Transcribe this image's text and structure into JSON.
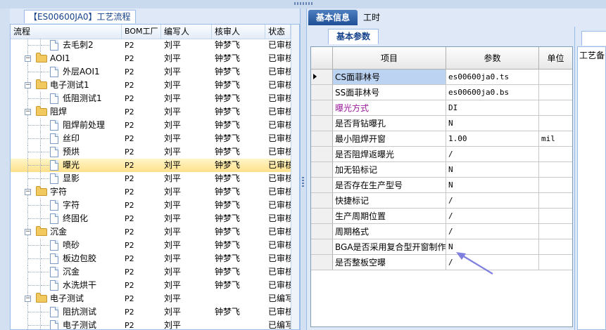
{
  "left_panel": {
    "tab_title": "【ES00600JA0】工艺流程",
    "columns": [
      "流程",
      "BOM工厂",
      "编写人",
      "核审人",
      "状态"
    ],
    "rows": [
      {
        "type": "leaf",
        "level": 2,
        "name": "去毛刺2",
        "bom": "P2",
        "writer": "刘平",
        "reviewer": "钟梦飞",
        "status": "已审核"
      },
      {
        "type": "folder",
        "level": 1,
        "name": "AOI1",
        "bom": "P2",
        "writer": "刘平",
        "reviewer": "钟梦飞",
        "status": "已审核"
      },
      {
        "type": "leaf",
        "level": 2,
        "name": "外层AOI1",
        "bom": "P2",
        "writer": "刘平",
        "reviewer": "钟梦飞",
        "status": "已审核"
      },
      {
        "type": "folder",
        "level": 1,
        "name": "电子测试1",
        "bom": "P2",
        "writer": "刘平",
        "reviewer": "钟梦飞",
        "status": "已审核"
      },
      {
        "type": "leaf",
        "level": 2,
        "name": "低阻测试1",
        "bom": "P2",
        "writer": "刘平",
        "reviewer": "钟梦飞",
        "status": "已审核"
      },
      {
        "type": "folder",
        "level": 1,
        "name": "阻焊",
        "bom": "P2",
        "writer": "刘平",
        "reviewer": "钟梦飞",
        "status": "已审核"
      },
      {
        "type": "leaf",
        "level": 2,
        "name": "阻焊前处理",
        "bom": "P2",
        "writer": "刘平",
        "reviewer": "钟梦飞",
        "status": "已审核"
      },
      {
        "type": "leaf",
        "level": 2,
        "name": "丝印",
        "bom": "P2",
        "writer": "刘平",
        "reviewer": "钟梦飞",
        "status": "已审核"
      },
      {
        "type": "leaf",
        "level": 2,
        "name": "预烘",
        "bom": "P2",
        "writer": "刘平",
        "reviewer": "钟梦飞",
        "status": "已审核"
      },
      {
        "type": "leaf",
        "level": 2,
        "name": "曝光",
        "bom": "P2",
        "writer": "刘平",
        "reviewer": "钟梦飞",
        "status": "已审核",
        "selected": true
      },
      {
        "type": "leaf",
        "level": 2,
        "name": "显影",
        "bom": "P2",
        "writer": "刘平",
        "reviewer": "钟梦飞",
        "status": "已审核"
      },
      {
        "type": "folder",
        "level": 1,
        "name": "字符",
        "bom": "P2",
        "writer": "刘平",
        "reviewer": "钟梦飞",
        "status": "已审核"
      },
      {
        "type": "leaf",
        "level": 2,
        "name": "字符",
        "bom": "P2",
        "writer": "刘平",
        "reviewer": "钟梦飞",
        "status": "已审核"
      },
      {
        "type": "leaf",
        "level": 2,
        "name": "终固化",
        "bom": "P2",
        "writer": "刘平",
        "reviewer": "钟梦飞",
        "status": "已审核"
      },
      {
        "type": "folder",
        "level": 1,
        "name": "沉金",
        "bom": "P2",
        "writer": "刘平",
        "reviewer": "钟梦飞",
        "status": "已审核"
      },
      {
        "type": "leaf",
        "level": 2,
        "name": "喷砂",
        "bom": "P2",
        "writer": "刘平",
        "reviewer": "钟梦飞",
        "status": "已审核"
      },
      {
        "type": "leaf",
        "level": 2,
        "name": "板边包胶",
        "bom": "P2",
        "writer": "刘平",
        "reviewer": "钟梦飞",
        "status": "已审核"
      },
      {
        "type": "leaf",
        "level": 2,
        "name": "沉金",
        "bom": "P2",
        "writer": "刘平",
        "reviewer": "钟梦飞",
        "status": "已审核"
      },
      {
        "type": "leaf",
        "level": 2,
        "name": "水洗烘干",
        "bom": "P2",
        "writer": "刘平",
        "reviewer": "钟梦飞",
        "status": "已审核"
      },
      {
        "type": "folder",
        "level": 1,
        "name": "电子测试",
        "bom": "P2",
        "writer": "刘平",
        "reviewer": "",
        "status": "已编写"
      },
      {
        "type": "leaf",
        "level": 2,
        "name": "阻抗测试",
        "bom": "P2",
        "writer": "刘平",
        "reviewer": "钟梦飞",
        "status": "已审核"
      },
      {
        "type": "leaf",
        "level": 2,
        "name": "电子测试",
        "bom": "P2",
        "writer": "刘平",
        "reviewer": "",
        "status": "已编写"
      }
    ]
  },
  "right_panel": {
    "tabs": [
      "基本信息",
      "工时"
    ],
    "sub_tab": "基本参数",
    "side_label": "工艺备",
    "columns": [
      "项目",
      "参数",
      "单位"
    ],
    "rows": [
      {
        "item": "CS面菲林号",
        "param": "es00600ja0.ts",
        "unit": "",
        "current": true,
        "highlight": true
      },
      {
        "item": "SS面菲林号",
        "param": "es00600ja0.bs",
        "unit": ""
      },
      {
        "item": "曝光方式",
        "param": "DI",
        "unit": "",
        "purple": true
      },
      {
        "item": "是否背钻曝孔",
        "param": "N",
        "unit": ""
      },
      {
        "item": "最小阻焊开窗",
        "param": "1.00",
        "unit": "mil"
      },
      {
        "item": "是否阻焊返曝光",
        "param": "/",
        "unit": ""
      },
      {
        "item": "加无铅标记",
        "param": "N",
        "unit": ""
      },
      {
        "item": "是否存在生产型号",
        "param": "N",
        "unit": ""
      },
      {
        "item": "快捷标记",
        "param": "/",
        "unit": ""
      },
      {
        "item": "生产周期位置",
        "param": "/",
        "unit": ""
      },
      {
        "item": "周期格式",
        "param": "/",
        "unit": ""
      },
      {
        "item": "BGA是否采用复合型开窗制作",
        "param": "N",
        "unit": ""
      },
      {
        "item": "是否整板空曝",
        "param": "/",
        "unit": ""
      }
    ]
  },
  "colors": {
    "accent": "#1e4f96",
    "selected_row": "#ffe08a",
    "highlight_cell": "#bcd3f2",
    "purple_text": "#9b1b9b",
    "arrow": "#7f7fe0"
  }
}
